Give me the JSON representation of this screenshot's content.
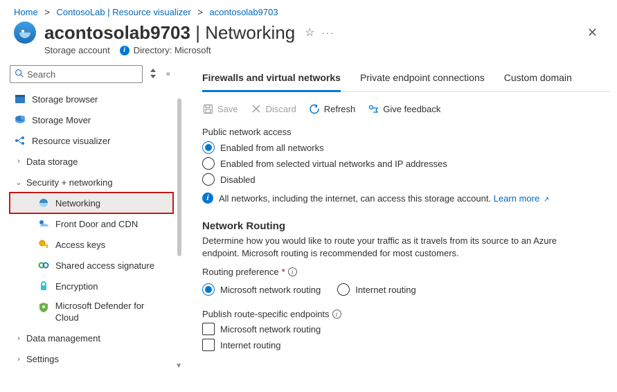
{
  "breadcrumb": {
    "home": "Home",
    "lab": "ContosoLab | Resource visualizer",
    "resource": "acontosolab9703"
  },
  "header": {
    "title_main": "acontosolab9703",
    "title_section": "Networking",
    "subtitle": "Storage account",
    "directory_label": "Directory:",
    "directory_value": "Microsoft"
  },
  "search": {
    "placeholder": "Search"
  },
  "sidebar": {
    "storage_browser": "Storage browser",
    "storage_mover": "Storage Mover",
    "resource_visualizer": "Resource visualizer",
    "data_storage": "Data storage",
    "security_networking": "Security + networking",
    "networking": "Networking",
    "front_door": "Front Door and CDN",
    "access_keys": "Access keys",
    "sas": "Shared access signature",
    "encryption": "Encryption",
    "defender": "Microsoft Defender for Cloud",
    "data_management": "Data management",
    "settings": "Settings"
  },
  "tabs": {
    "firewalls": "Firewalls and virtual networks",
    "private": "Private endpoint connections",
    "custom": "Custom domain"
  },
  "toolbar": {
    "save": "Save",
    "discard": "Discard",
    "refresh": "Refresh",
    "feedback": "Give feedback"
  },
  "pna": {
    "label": "Public network access",
    "opt1": "Enabled from all networks",
    "opt2": "Enabled from selected virtual networks and IP addresses",
    "opt3": "Disabled",
    "info": "All networks, including the internet, can access this storage account.",
    "learn_more": "Learn more"
  },
  "routing": {
    "heading": "Network Routing",
    "desc": "Determine how you would like to route your traffic as it travels from its source to an Azure endpoint. Microsoft routing is recommended for most customers.",
    "pref_label": "Routing preference",
    "opt_ms": "Microsoft network routing",
    "opt_inet": "Internet routing",
    "publish_label": "Publish route-specific endpoints",
    "chk_ms": "Microsoft network routing",
    "chk_inet": "Internet routing"
  }
}
